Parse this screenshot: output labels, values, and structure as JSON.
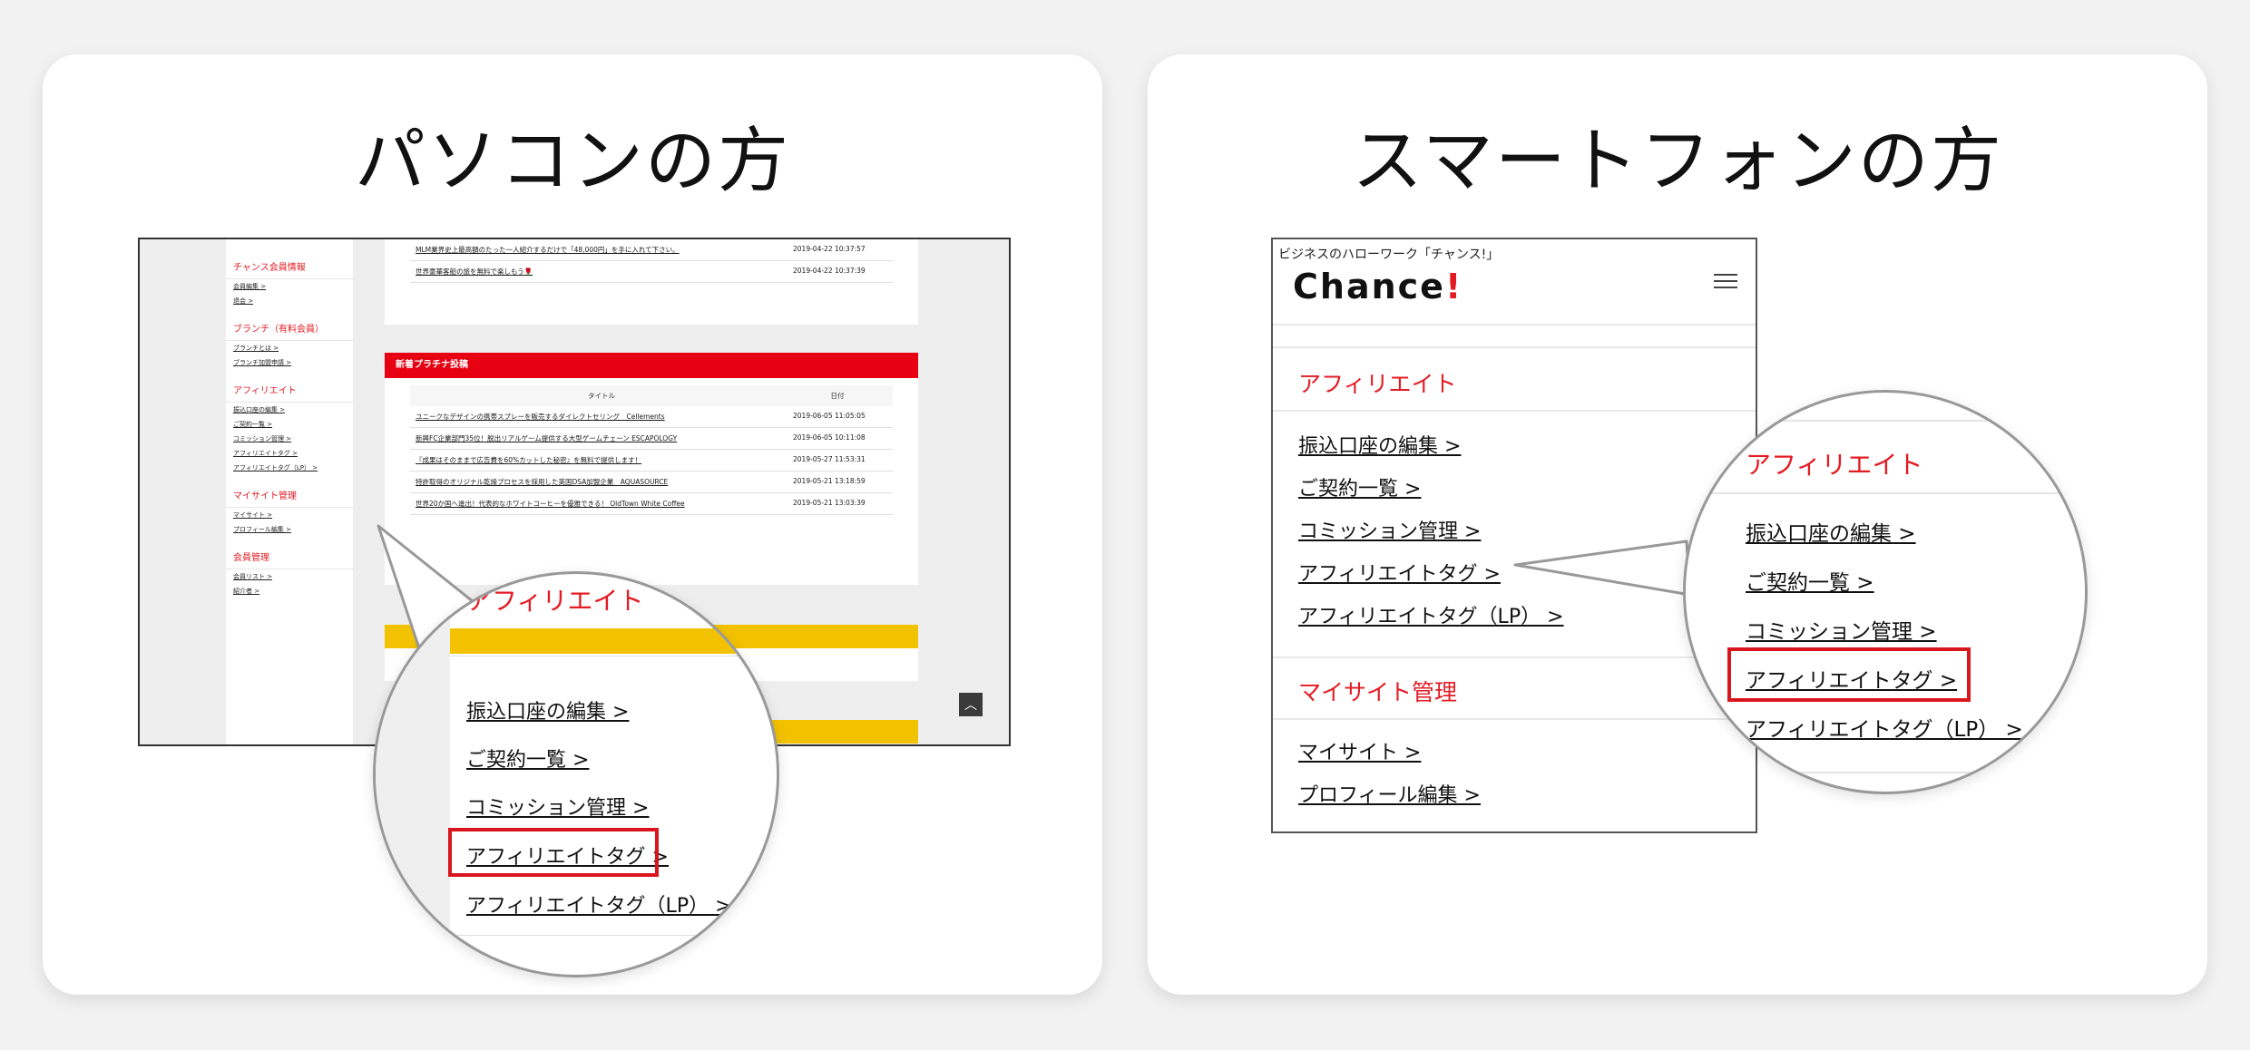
{
  "pc_panel": {
    "title": "パソコンの方",
    "sidebar": [
      {
        "group": "チャンス会員情報",
        "links": [
          "会員編集 >",
          "退会 >"
        ]
      },
      {
        "group": "ブランチ（有料会員）",
        "links": [
          "ブランチとは >",
          "ブランチ加盟申請 >"
        ]
      },
      {
        "group": "アフィリエイト",
        "links": [
          "振込口座の編集 >",
          "ご契約一覧 >",
          "コミッション管理 >",
          "アフィリエイトタグ >",
          "アフィリエイトタグ（LP） >"
        ]
      },
      {
        "group": "マイサイト管理",
        "links": [
          "マイサイト >",
          "プロフィール編集 >"
        ]
      },
      {
        "group": "会員管理",
        "links": [
          "会員リスト >",
          "紹介者 >"
        ]
      }
    ],
    "top_rows": [
      {
        "title": "MLM業界史上最高額のたった一人紹介するだけで「48,000円」を手に入れて下さい。",
        "date": "2019-04-22 10:37:57"
      },
      {
        "title": "世界豪華客船の旅を無料で楽しもう🌹",
        "date": "2019-04-22 10:37:39"
      }
    ],
    "platinum": {
      "heading": "新着プラチナ投稿",
      "col_title": "タイトル",
      "col_date": "日付",
      "rows": [
        {
          "title": "ユニークなデザインの携帯スプレーを販売するダイレクトセリング　Cellements",
          "date": "2019-06-05 11:05:05"
        },
        {
          "title": "新興FC企業部門35位！脱出リアルゲーム提供する大型ゲームチェーン ESCAPOLOGY",
          "date": "2019-06-05 10:11:08"
        },
        {
          "title": "『成果はそのままで広告費を60%カットした秘密』を無料で提供します！",
          "date": "2019-05-27 11:53:31"
        },
        {
          "title": "特許取得のオリジナル乾燥プロセスを採用した英国DSA加盟企業　AQUASOURCE",
          "date": "2019-05-21 13:18:59"
        },
        {
          "title": "世界20か国へ進出！代表的なホワイトコーヒーを優雅できる！ OldTown White Coffee",
          "date": "2019-05-21 13:03:39"
        }
      ]
    },
    "pagetop_icon": "chevron-up-icon",
    "magnifier": {
      "title": "アフィリエイト",
      "items": [
        "振込口座の編集 >",
        "ご契約一覧 >",
        "コミッション管理 >",
        "アフィリエイトタグ >",
        "アフィリエイトタグ（LP） >"
      ],
      "highlighted_index": 3
    }
  },
  "sp_panel": {
    "title": "スマートフォンの方",
    "tagline": "ビジネスのハローワーク「チャンス!」",
    "logo_text": "Chance",
    "logo_mark": "!",
    "menu_icon": "hamburger-icon",
    "affiliate_group": "アフィリエイト",
    "affiliate_items": [
      "振込口座の編集 >",
      "ご契約一覧 >",
      "コミッション管理 >",
      "アフィリエイトタグ >",
      "アフィリエイトタグ（LP） >"
    ],
    "mysite_group": "マイサイト管理",
    "mysite_items": [
      "マイサイト >",
      "プロフィール編集 >"
    ],
    "magnifier": {
      "title": "アフィリエイト",
      "items": [
        "振込口座の編集 >",
        "ご契約一覧 >",
        "コミッション管理 >",
        "アフィリエイトタグ >",
        "アフィリエイトタグ（LP） >"
      ],
      "highlighted_index": 3
    }
  },
  "colors": {
    "accent_red": "#e31b23",
    "header_red": "#e60012",
    "yellow": "#f2c200"
  }
}
